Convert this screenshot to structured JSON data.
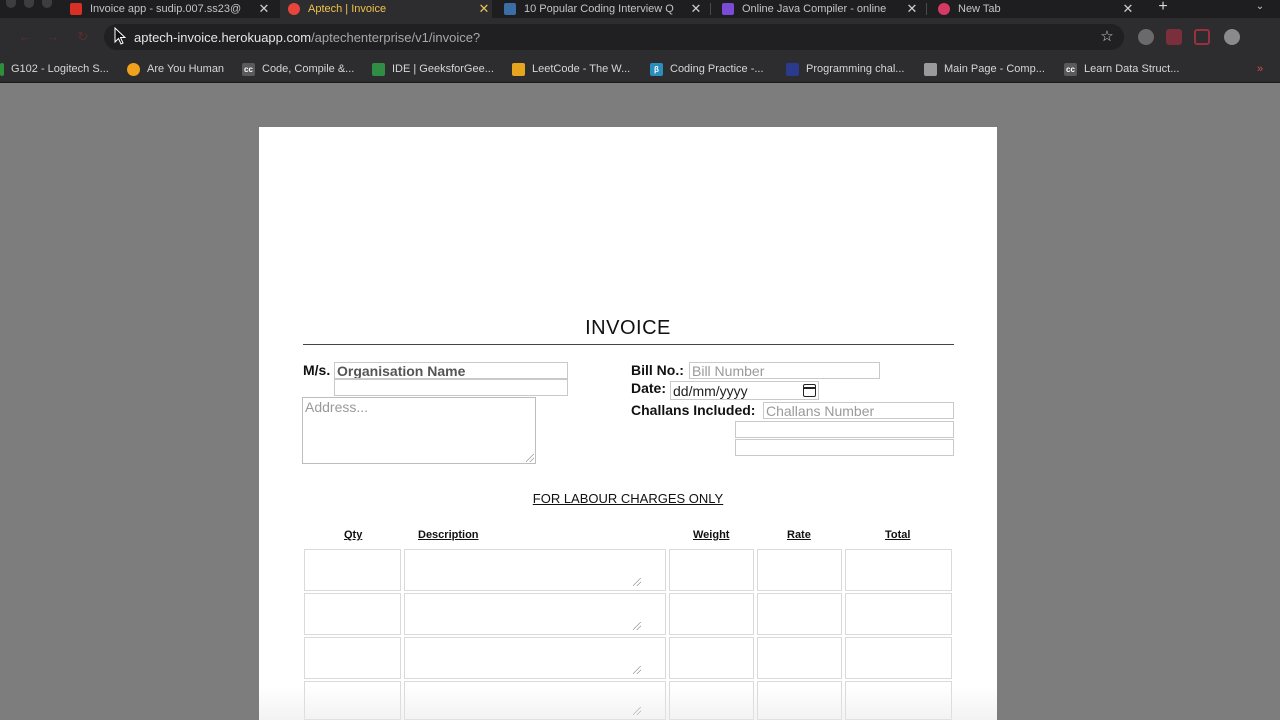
{
  "browser": {
    "tabs": [
      {
        "title": "Invoice app - sudip.007.ss23@",
        "favicon_color": "#d93025",
        "active": false
      },
      {
        "title": "Aptech | Invoice",
        "favicon_color": "#e8453c",
        "active": true
      },
      {
        "title": "10 Popular Coding Interview Q",
        "favicon_color": "#3b6ea5",
        "active": false
      },
      {
        "title": "Online Java Compiler - online",
        "favicon_color": "#7b4bd6",
        "active": false
      },
      {
        "title": "New Tab",
        "favicon_color": "#d63a63",
        "active": false
      }
    ],
    "close_glyph": "✕",
    "new_tab_glyph": "+",
    "tab_menu_glyph": "⌄",
    "nav": {
      "back": "←",
      "forward": "→",
      "reload": "↻",
      "home": "⌂"
    },
    "url": {
      "domain": "aptech-invoice.herokuapp.com",
      "path": "/aptechenterprise/v1/invoice?"
    },
    "star_glyph": "☆",
    "bookmarks": [
      {
        "label": "G102 - Logitech S...",
        "icon_color": "#2f8f3a",
        "icon_text": ""
      },
      {
        "label": "Are You Human",
        "icon_color": "#f0a21c",
        "icon_text": ""
      },
      {
        "label": "Code, Compile &...",
        "icon_color": "#5a5a5a",
        "icon_text": "cc"
      },
      {
        "label": "IDE | GeeksforGee...",
        "icon_color": "#2f8d46",
        "icon_text": ""
      },
      {
        "label": "LeetCode - The W...",
        "icon_color": "#e7a41f",
        "icon_text": ""
      },
      {
        "label": "Coding Practice -...",
        "icon_color": "#2a8fbd",
        "icon_text": "β"
      },
      {
        "label": "Programming chal...",
        "icon_color": "#2b3a8c",
        "icon_text": ""
      },
      {
        "label": "Main Page - Comp...",
        "icon_color": "#9a9a9a",
        "icon_text": ""
      },
      {
        "label": "Learn Data Struct...",
        "icon_color": "#5a5a5a",
        "icon_text": "cc"
      }
    ],
    "bookmarks_more": "»"
  },
  "invoice": {
    "title": "INVOICE",
    "ms_label": "M/s.",
    "org_placeholder": "Organisation Name",
    "address_placeholder": "Address...",
    "bill_no_label": "Bill No.:",
    "bill_no_placeholder": "Bill Number",
    "date_label": "Date:",
    "date_placeholder": "dd/mm/yyyy",
    "challans_label": "Challans Included:",
    "challans_placeholder": "Challans Number",
    "subtitle": "FOR LABOUR CHARGES ONLY",
    "columns": {
      "qty": "Qty",
      "description": "Description",
      "weight": "Weight",
      "rate": "Rate",
      "total": "Total"
    },
    "rows": [
      {
        "qty": "",
        "description": "",
        "weight": "",
        "rate": "",
        "total": ""
      },
      {
        "qty": "",
        "description": "",
        "weight": "",
        "rate": "",
        "total": ""
      },
      {
        "qty": "",
        "description": "",
        "weight": "",
        "rate": "",
        "total": ""
      },
      {
        "qty": "",
        "description": "",
        "weight": "",
        "rate": "",
        "total": ""
      }
    ]
  }
}
